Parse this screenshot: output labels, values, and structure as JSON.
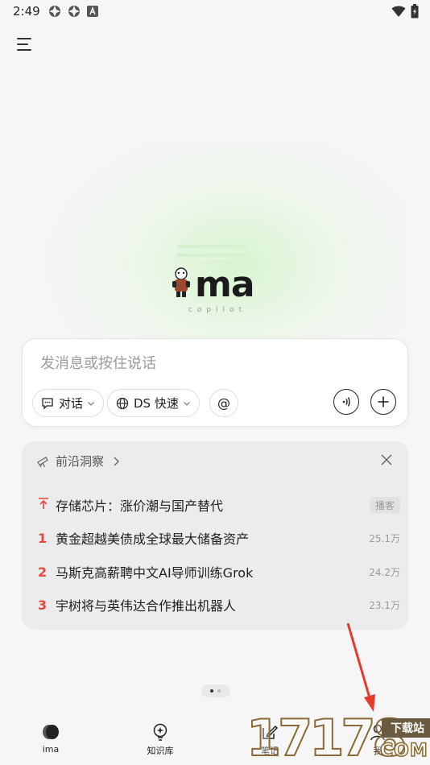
{
  "status_bar": {
    "time": "2:49",
    "icons": [
      "app-icon-1",
      "app-icon-2",
      "a-icon",
      "wifi-icon",
      "battery-icon"
    ]
  },
  "header": {
    "menu_icon": "hamburger-icon"
  },
  "logo": {
    "text": "ma",
    "subtitle": "copilot"
  },
  "input": {
    "placeholder": "发消息或按住说话",
    "mode_chip": "对话",
    "model_chip": "DS 快速",
    "at_button": "@"
  },
  "trending": {
    "title": "前沿洞察",
    "items": [
      {
        "rank": "",
        "title": "存储芯片：涨价潮与国产替代",
        "meta": "播客"
      },
      {
        "rank": "1",
        "title": "黄金超越美债成全球最大储备资产",
        "meta": "25.1万"
      },
      {
        "rank": "2",
        "title": "马斯克高薪聘中文AI导师训练Grok",
        "meta": "24.2万"
      },
      {
        "rank": "3",
        "title": "宇树将与英伟达合作推出机器人",
        "meta": "23.1万"
      }
    ]
  },
  "pager": {
    "pages": 2,
    "current": 1
  },
  "bottom_nav": {
    "items": [
      {
        "label": "ima",
        "icon": "ima-logo-icon"
      },
      {
        "label": "知识库",
        "icon": "bulb-icon"
      },
      {
        "label": "笔记",
        "icon": "note-edit-icon"
      },
      {
        "label": "我",
        "icon": "person-icon"
      }
    ]
  },
  "watermark": {
    "digits": "17178",
    "badge": "下载站",
    "domain": "COM"
  },
  "colors": {
    "accent_red": "#e2483d",
    "annotation_arrow": "#e33a2c"
  }
}
